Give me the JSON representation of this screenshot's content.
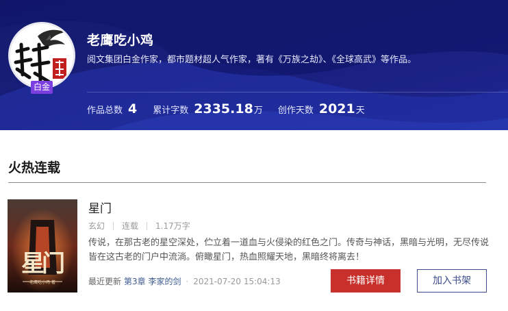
{
  "author": {
    "name": "老鹰吃小鸡",
    "badge": "白金",
    "description": "阅文集团白金作家，都市题材超人气作家，著有《万族之劫》、《全球高武》等作品。",
    "avatar_text": "鹰萌",
    "avatar_stamp": "老鹰",
    "stats": [
      {
        "label": "作品总数",
        "value": "4",
        "unit": ""
      },
      {
        "label": "累计字数",
        "value": "2335.18",
        "unit": "万"
      },
      {
        "label": "创作天数",
        "value": "2021",
        "unit": "天"
      }
    ]
  },
  "section": {
    "title": "火热连载"
  },
  "book": {
    "title": "星门",
    "genre": "玄幻",
    "status": "连载",
    "word_count": "1.17万字",
    "description": "传说，在那古老的星空深处，伫立着一道血与火侵染的红色之门。传奇与神话，黑暗与光明，无尽传说皆在这古老的门户中流淌。俯瞰星门，热血照耀天地，黑暗终将离去！",
    "update_label": "最近更新",
    "latest_chapter": "第3章 李家的剑",
    "update_time": "2021-07-20 15:04:13",
    "cover_title": "星门",
    "cover_author": "老鹰吃小鸡 著",
    "detail_button": "书籍详情",
    "shelf_button": "加入书架"
  },
  "colors": {
    "banner": "#1a1f7a",
    "badge": "#7b3fe0",
    "primary_button": "#c8302b",
    "secondary_border": "#3b4b8c"
  }
}
